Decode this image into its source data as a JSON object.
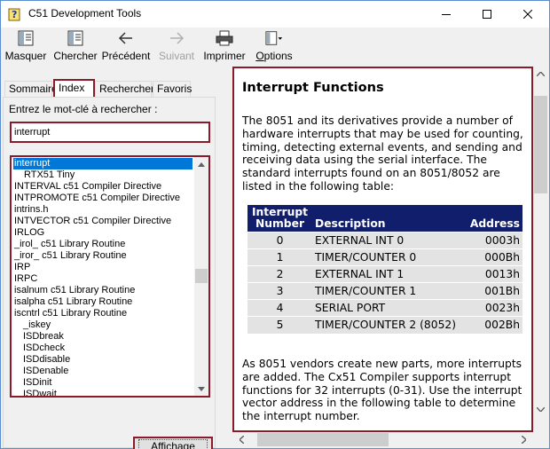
{
  "window": {
    "title": "C51 Development Tools"
  },
  "toolbar": {
    "hide": "Masquer",
    "search": "Chercher",
    "back": "Précédent",
    "forward": "Suivant",
    "print": "Imprimer",
    "options": "Options"
  },
  "tabs": [
    {
      "label": "Sommaire"
    },
    {
      "label": "Index"
    },
    {
      "label": "Rechercher"
    },
    {
      "label": "Favoris"
    }
  ],
  "index": {
    "prompt": "Entrez le mot-clé à rechercher :",
    "keyword": "interrupt",
    "items": [
      "interrupt",
      "RTX51 Tiny",
      "INTERVAL c51 Compiler Directive",
      "INTPROMOTE c51 Compiler Directive",
      "intrins.h",
      "INTVECTOR c51 Compiler Directive",
      "IRLOG",
      "_irol_ c51 Library Routine",
      "_iror_ c51 Library Routine",
      "IRP",
      "IRPC",
      "isalnum c51 Library Routine",
      "isalpha c51 Library Routine",
      "iscntrl c51 Library Routine",
      "_iskey",
      "ISDbreak",
      "ISDcheck",
      "ISDdisable",
      "ISDenable",
      "ISDinit",
      "ISDwait"
    ],
    "display_button": "Affichage"
  },
  "topic": {
    "title": "Interrupt Functions",
    "intro": "The 8051 and its derivatives provide a number of hardware interrupts that may be used for counting, timing, detecting external events, and sending and receiving data using the serial interface. The standard interrupts found on an 8051/8052 are listed in the following table:",
    "table": {
      "headers": [
        "Interrupt Number",
        "Description",
        "Address"
      ],
      "rows": [
        [
          "0",
          "EXTERNAL INT 0",
          "0003h"
        ],
        [
          "1",
          "TIMER/COUNTER 0",
          "000Bh"
        ],
        [
          "2",
          "EXTERNAL INT 1",
          "0013h"
        ],
        [
          "3",
          "TIMER/COUNTER 1",
          "001Bh"
        ],
        [
          "4",
          "SERIAL PORT",
          "0023h"
        ],
        [
          "5",
          "TIMER/COUNTER 2 (8052)",
          "002Bh"
        ]
      ]
    },
    "outro": "As 8051 vendors create new parts, more interrupts are added. The Cx51 Compiler supports interrupt functions for 32 interrupts (0-31). Use the interrupt vector address in the following table to determine the interrupt number."
  },
  "colors": {
    "highlight_border": "#8b1a2b",
    "table_header": "#101e6c",
    "table_row": "#e3e3e3",
    "selection": "#0078d7"
  }
}
